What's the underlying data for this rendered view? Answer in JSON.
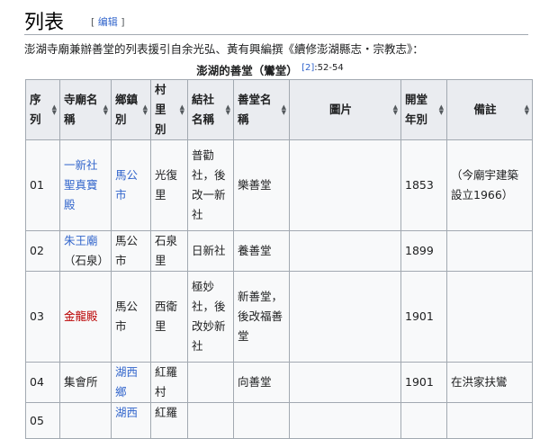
{
  "section": {
    "title": "列表",
    "edit_open": "[ ",
    "edit_label": "编辑",
    "edit_close": " ]"
  },
  "intro": "澎湖寺廟兼辦善堂的列表援引自余光弘、黃有興編撰《續修澎湖縣志・宗教志》：",
  "caption": {
    "title": "澎湖的善堂（鸞堂）",
    "ref_label": "[2]",
    "ref_pages": ":52-54"
  },
  "columns": [
    {
      "label": "序列"
    },
    {
      "label": "寺廟名稱"
    },
    {
      "label": "鄉鎮別"
    },
    {
      "label": "村里別"
    },
    {
      "label": "結社名稱"
    },
    {
      "label": "善堂名稱"
    },
    {
      "label": "圖片"
    },
    {
      "label": "開堂年別"
    },
    {
      "label": "備註"
    }
  ],
  "rows": [
    {
      "seq": "01",
      "temple": "一新社聖真寶殿",
      "township": "馬公市",
      "village": "光復里",
      "society": "普勸社，後改一新社",
      "hall": "樂善堂",
      "image": "",
      "year": "1853",
      "note": "（今廟宇建築設立1966）"
    },
    {
      "seq": "02",
      "temple": "朱王廟",
      "temple_extra": "（石泉）",
      "township": "馬公市",
      "village": "石泉里",
      "society": "日新社",
      "hall": "養善堂",
      "image": "",
      "year": "1899",
      "note": ""
    },
    {
      "seq": "03",
      "temple": "金龍殿",
      "township": "馬公市",
      "village": "西衛里",
      "society": "極妙社，後改妙新社",
      "hall": "新善堂，後改福善堂",
      "image": "",
      "year": "1901",
      "note": ""
    },
    {
      "seq": "04",
      "temple": "集會所",
      "township": "湖西鄉",
      "village": "紅羅村",
      "society": "",
      "hall": "向善堂",
      "image": "",
      "year": "1901",
      "note": "在洪家扶鸞"
    },
    {
      "seq": "05",
      "temple": "",
      "township": "湖西",
      "village": "紅羅",
      "society": "",
      "hall": "",
      "image": "",
      "year": "",
      "note": ""
    }
  ],
  "colors": {
    "link": "#3366cc",
    "redlink": "#ba0000",
    "header_bg": "#eaecf0",
    "cell_bg": "#f8f9fa",
    "border": "#a2a9b1"
  },
  "icons": {
    "sort": "sort-arrows-icon"
  }
}
